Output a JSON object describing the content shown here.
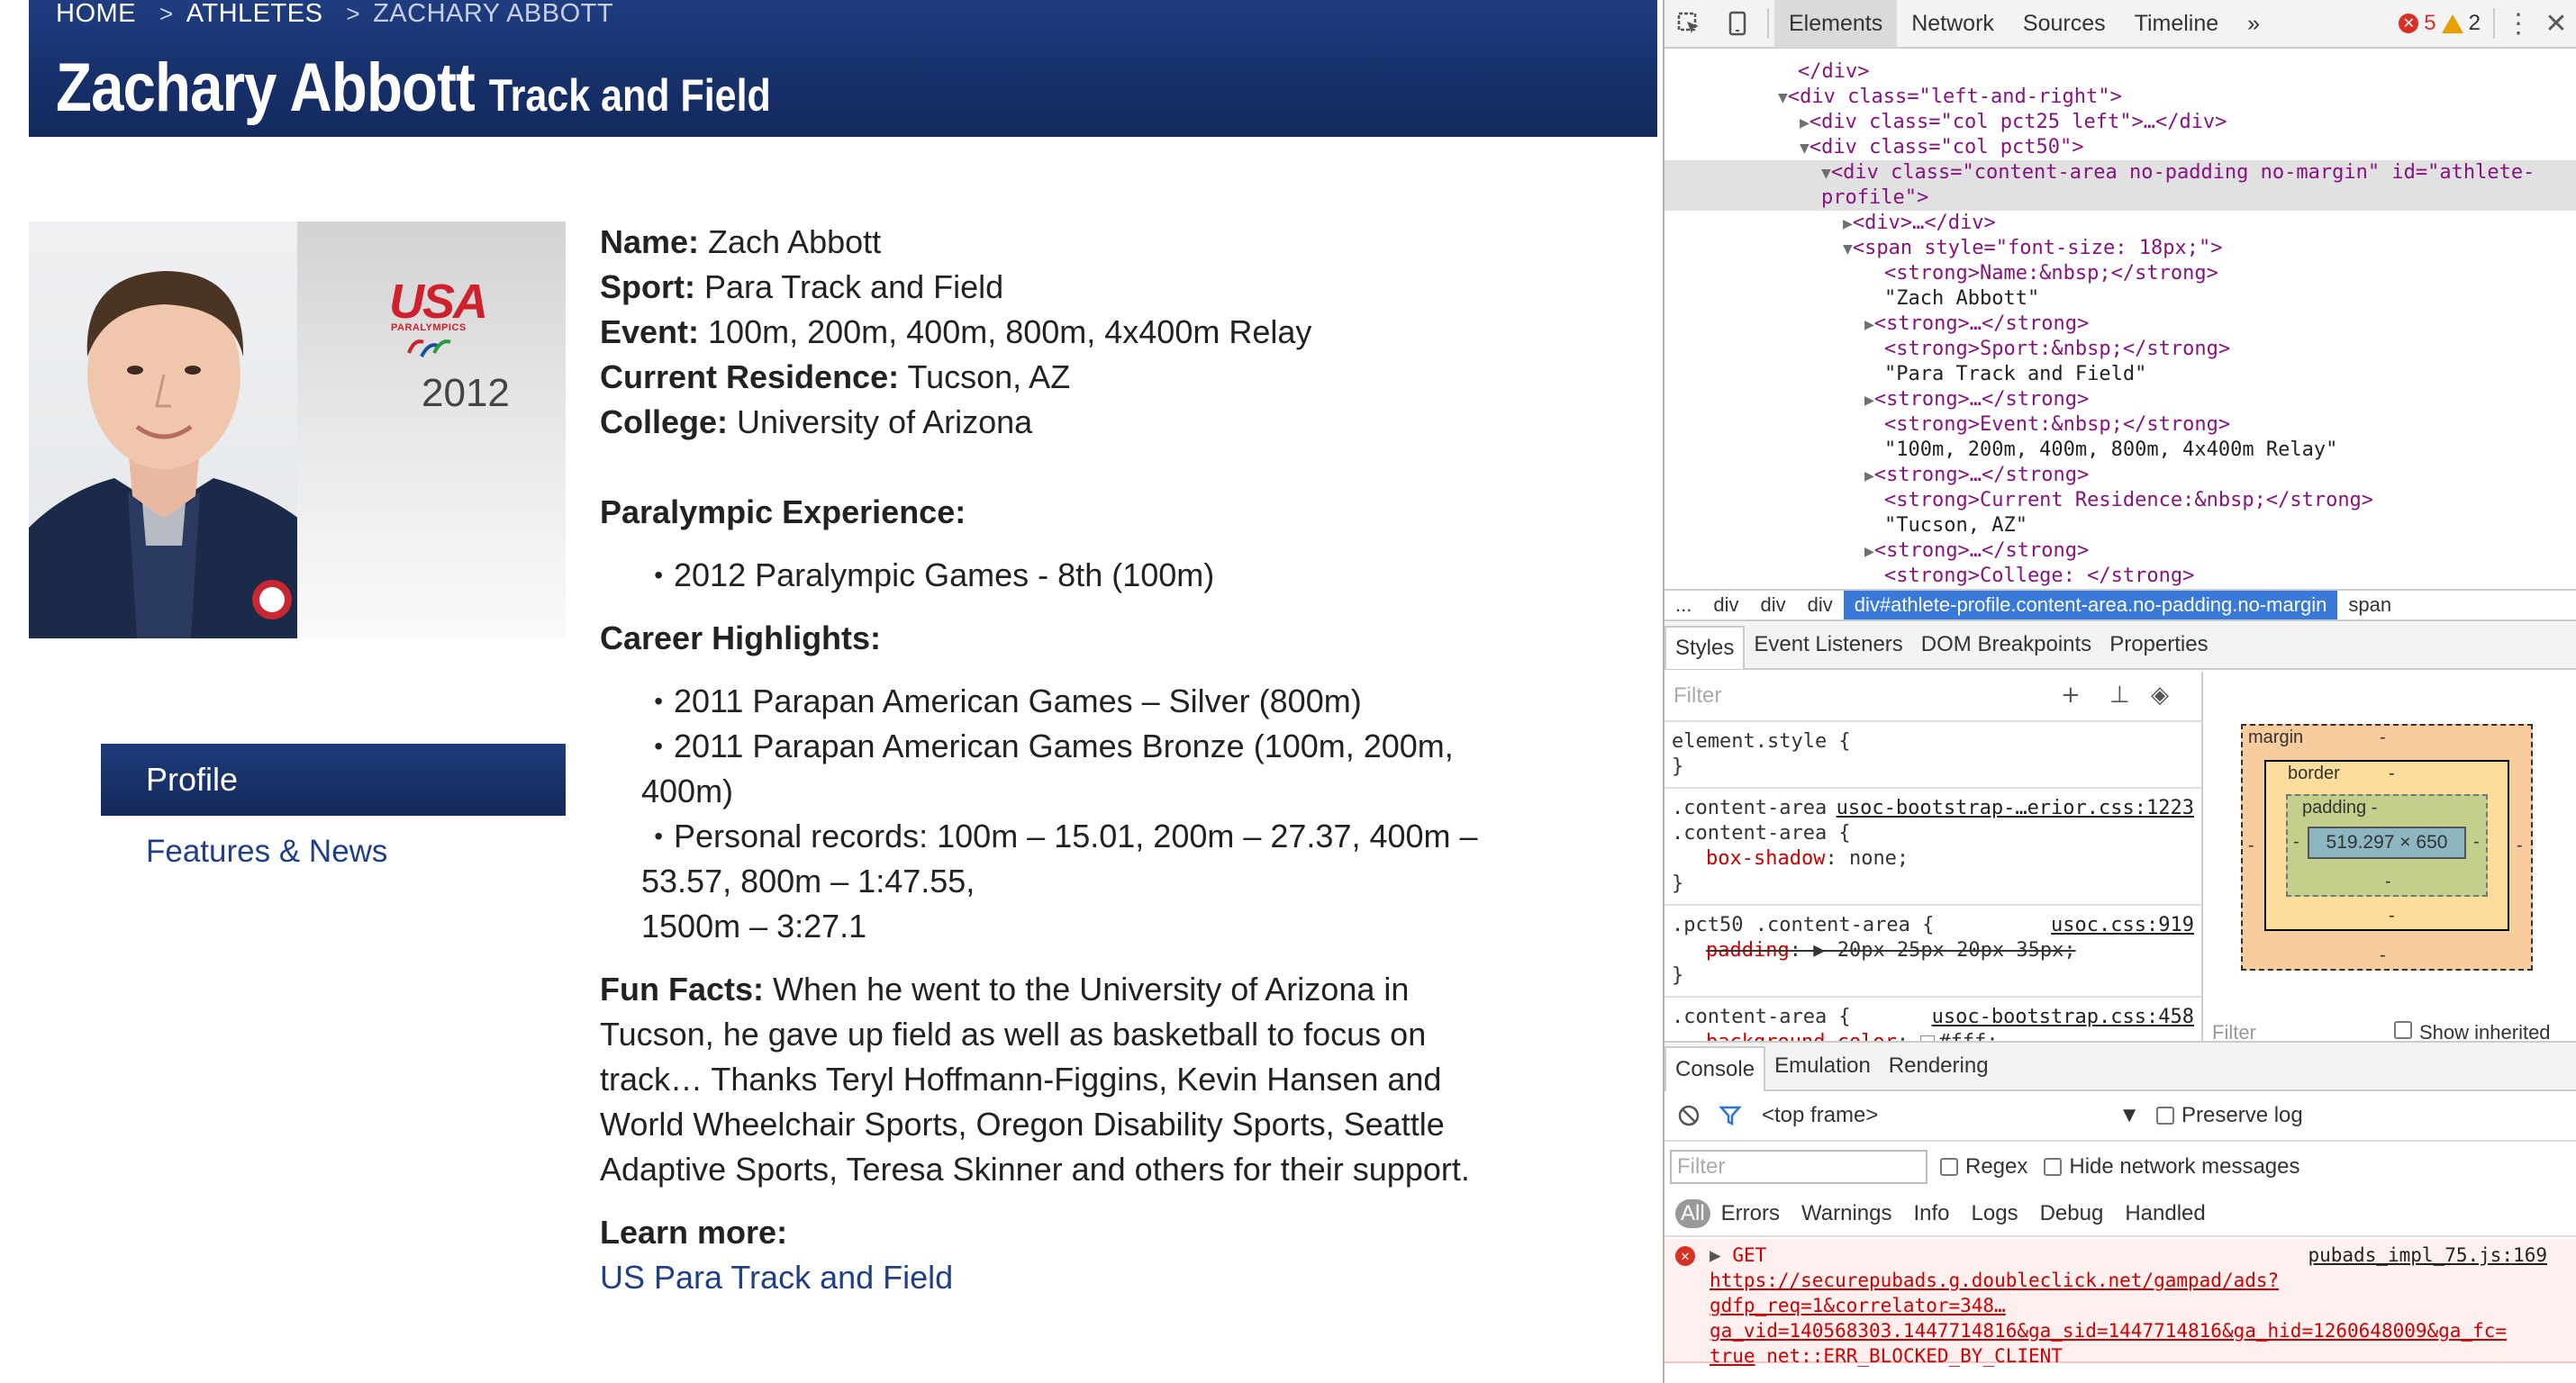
{
  "site": {
    "breadcrumb": [
      {
        "label": "HOME"
      },
      {
        "label": "ATHLETES"
      },
      {
        "label": "ZACHARY ABBOTT"
      }
    ],
    "title_name": "Zachary Abbott",
    "title_sport": "Track and Field",
    "badge": {
      "brand": "USA",
      "sub": "PARALYMPICS",
      "year": "2012"
    },
    "nav": {
      "profile": "Profile",
      "features": "Features & News"
    },
    "profile": {
      "facts": [
        {
          "label": "Name:",
          "value": " Zach Abbott"
        },
        {
          "label": "Sport:",
          "value": " Para Track and Field"
        },
        {
          "label": "Event:",
          "value": " 100m, 200m, 400m, 800m, 4x400m Relay"
        },
        {
          "label": "Current Residence:",
          "value": " Tucson, AZ"
        },
        {
          "label": "College:",
          "value": " University of Arizona"
        }
      ],
      "experience_heading": "Paralympic Experience:",
      "experience_items": [
        "2012 Paralympic Games - 8th (100m)"
      ],
      "highlights_heading": "Career Highlights:",
      "highlights_items": [
        "2011 Parapan American Games – Silver (800m)",
        "2011 Parapan American Games Bronze (100m, 200m,",
        "Personal records: 100m – 15.01, 200m – 27.37, 400m –"
      ],
      "highlights_wraps": [
        "400m)",
        "53.57, 800m – 1:47.55,",
        "1500m – 3:27.1"
      ],
      "fun_label": "Fun Facts:",
      "fun_lines": [
        " When he went to the University of Arizona in",
        "Tucson, he gave up field as well as basketball to focus on",
        "track… Thanks Teryl Hoffmann-Figgins, Kevin Hansen and",
        "World Wheelchair Sports, Oregon Disability Sports, Seattle",
        "Adaptive Sports, Teresa Skinner and others for their support."
      ],
      "learn_label": "Learn more:",
      "learn_link": "US Para Track and Field"
    }
  },
  "devtools": {
    "tabs": [
      "Elements",
      "Network",
      "Sources",
      "Timeline"
    ],
    "more": "»",
    "errors": "5",
    "warnings": "2",
    "dom_lines": [
      "</div>",
      "<div class=\"left-and-right\">",
      "<div class=\"col pct25 left\">…</div>",
      "<div class=\"col pct50\">",
      "<div class=\"content-area no-padding no-margin\" id=\"athlete-",
      "profile\">",
      "<div>…</div>",
      "<span style=\"font-size: 18px;\">",
      "<strong>Name:&nbsp;</strong>",
      "\"Zach Abbott\"",
      "<strong>…</strong>",
      "<strong>Sport:&nbsp;</strong>",
      "\"Para Track and Field\"",
      "<strong>…</strong>",
      "<strong>Event:&nbsp;</strong>",
      "\"100m, 200m, 400m, 800m, 4x400m Relay\"",
      "<strong>…</strong>",
      "<strong>Current Residence:&nbsp;</strong>",
      "\"Tucson, AZ\"",
      "<strong>…</strong>",
      "<strong>College: </strong>"
    ],
    "dom_breadcrumb": [
      "...",
      "div",
      "div",
      "div",
      "div#athlete-profile.content-area.no-padding.no-margin",
      "span"
    ],
    "styles_tabs": [
      "Styles",
      "Event Listeners",
      "DOM Breakpoints",
      "Properties"
    ],
    "styles_filter": "Filter",
    "rules": [
      {
        "selector": "element.style {",
        "source": "",
        "props": [],
        "close": "}"
      },
      {
        "selector": ".content-area",
        "source": "usoc-bootstrap-…erior.css:1223",
        "selector2": ".content-area {",
        "props": [
          {
            "name": "box-shadow",
            "value": " none;"
          }
        ],
        "close": "}"
      },
      {
        "selector": ".pct50 .content-area {",
        "source": "usoc.css:919",
        "props": [
          {
            "name": "padding",
            "value": " ▶ 20px 25px 20px 35px;",
            "strike": true
          }
        ],
        "close": "}"
      },
      {
        "selector": ".content-area {",
        "source": "usoc-bootstrap.css:458",
        "props": [
          {
            "name": "background-color",
            "value": "#fff;"
          }
        ],
        "close": ""
      }
    ],
    "box_model": {
      "margin": "margin",
      "border": "border",
      "padding": "padding -",
      "content": "519.297 × 650",
      "dash": "-",
      "filter": "Filter",
      "inherited": "Show inherited"
    },
    "console_tabs": [
      "Console",
      "Emulation",
      "Rendering"
    ],
    "frame": "<top frame>",
    "preserve_log": "Preserve log",
    "console_filter": "Filter",
    "regex": "Regex",
    "hide_network": "Hide network messages",
    "levels": [
      "All",
      "Errors",
      "Warnings",
      "Info",
      "Logs",
      "Debug",
      "Handled"
    ],
    "message": {
      "method": "GET",
      "line1": "https://securepubads.g.doubleclick.net/gampad/ads?",
      "line2": "gdfp_req=1&correlator=348…",
      "line3": "ga_vid=140568303.1447714816&ga_sid=1447714816&ga_hid=1260648009&ga_fc=",
      "line4a": "true",
      "line4b": " net::ERR_BLOCKED_BY_CLIENT",
      "source": "pubads_impl_75.js:169"
    }
  }
}
